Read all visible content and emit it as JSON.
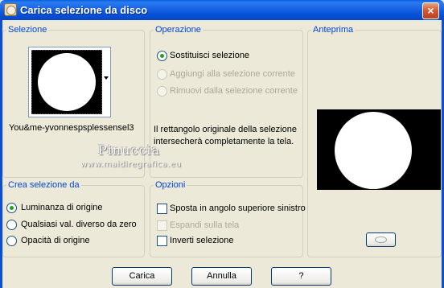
{
  "window": {
    "title": "Carica selezione da disco",
    "close_glyph": "×"
  },
  "selezione": {
    "legend": "Selezione",
    "file_name": "You&me-yvonnespsplessensel3"
  },
  "operazione": {
    "legend": "Operazione",
    "options": [
      {
        "label": "Sostituisci selezione",
        "selected": true,
        "enabled": true
      },
      {
        "label": "Aggiungi alla selezione corrente",
        "selected": false,
        "enabled": false
      },
      {
        "label": "Rimuovi dalla selezione corrente",
        "selected": false,
        "enabled": false
      }
    ],
    "info_line1": "Il rettangolo originale della selezione",
    "info_line2": "intersecherà completamente la tela."
  },
  "anteprima": {
    "legend": "Anteprima"
  },
  "watermark": {
    "line1": "Pinuccia",
    "line2": "www.maidiregrafica.eu"
  },
  "crea": {
    "legend": "Crea selezione da",
    "options": [
      {
        "label": "Luminanza di origine",
        "selected": true
      },
      {
        "label": "Qualsiasi val. diverso da zero",
        "selected": false
      },
      {
        "label": "Opacità di origine",
        "selected": false
      }
    ]
  },
  "opzioni": {
    "legend": "Opzioni",
    "items": [
      {
        "label": "Sposta in angolo superiore sinistro",
        "checked": false,
        "enabled": true
      },
      {
        "label": "Espandi sulla tela",
        "checked": false,
        "enabled": false
      },
      {
        "label": "Inverti selezione",
        "checked": false,
        "enabled": true
      }
    ]
  },
  "buttons": {
    "ok": "Carica",
    "cancel": "Annulla",
    "help": "?"
  },
  "colors": {
    "title_bar": "#0a5fe0",
    "dialog_bg": "#ece9d8",
    "group_label": "#0046d5",
    "radio_dot": "#21a121"
  }
}
